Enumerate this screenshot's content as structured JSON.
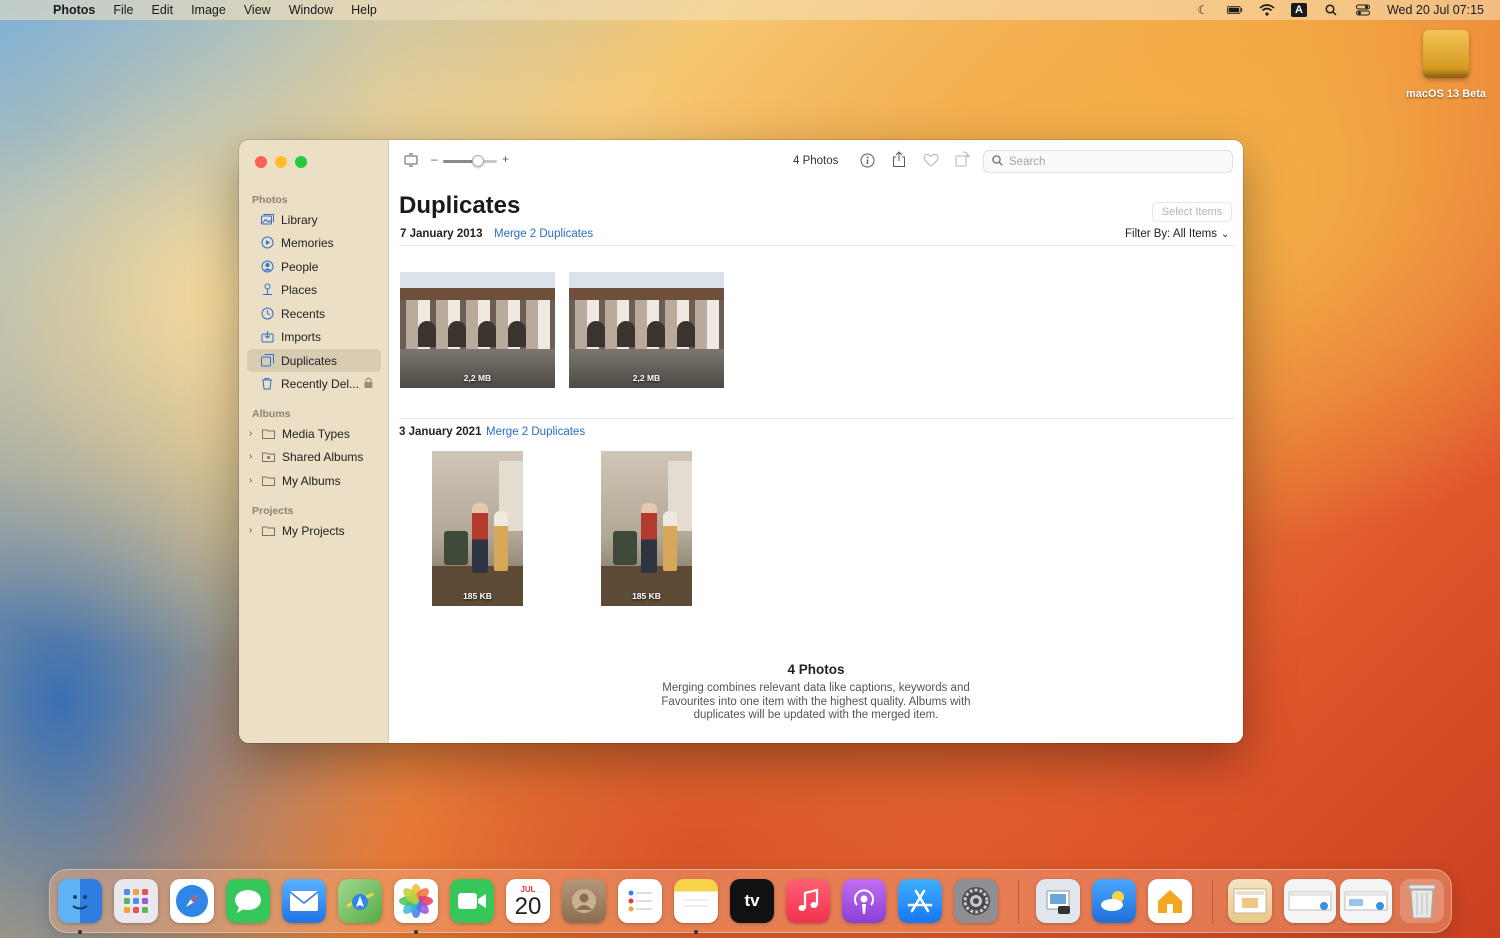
{
  "menubar": {
    "apple": "",
    "items": [
      "Photos",
      "File",
      "Edit",
      "Image",
      "View",
      "Window",
      "Help"
    ],
    "kbd": "A",
    "datetime": "Wed 20 Jul  07:15"
  },
  "desktop": {
    "disk_label": "macOS 13 Beta"
  },
  "sidebar": {
    "photos_header": "Photos",
    "photos_items": [
      {
        "label": "Library",
        "icon": "library-icon"
      },
      {
        "label": "Memories",
        "icon": "memories-icon"
      },
      {
        "label": "People",
        "icon": "people-icon"
      },
      {
        "label": "Places",
        "icon": "places-icon"
      },
      {
        "label": "Recents",
        "icon": "recents-icon"
      },
      {
        "label": "Imports",
        "icon": "imports-icon"
      },
      {
        "label": "Duplicates",
        "icon": "duplicates-icon",
        "selected": true
      },
      {
        "label": "Recently Del...",
        "icon": "trash-icon"
      }
    ],
    "albums_header": "Albums",
    "album_items": [
      "Media Types",
      "Shared Albums",
      "My Albums"
    ],
    "projects_header": "Projects",
    "project_items": [
      "My Projects"
    ]
  },
  "toolbar": {
    "zoom_minus": "–",
    "zoom_plus": "+",
    "zoom_level": 0.65,
    "photo_count": "4 Photos",
    "search_placeholder": "Search"
  },
  "main": {
    "title": "Duplicates",
    "select_items": "Select Items",
    "filter_label": "Filter By: All Items",
    "groups": [
      {
        "date": "7 January 2013",
        "merge": "Merge 2 Duplicates",
        "sizes": [
          "2,2 MB",
          "2,2 MB"
        ]
      },
      {
        "date": "3 January 2021",
        "merge": "Merge 2 Duplicates",
        "sizes": [
          "185 KB",
          "185 KB"
        ]
      }
    ],
    "footer_title": "4 Photos",
    "footer_desc": "Merging combines relevant data like captions, keywords and Favourites into one item with the highest quality. Albums with duplicates will be updated with the merged item."
  },
  "dock": {
    "calendar_month": "JUL",
    "calendar_day": "20",
    "tv_label": "tv",
    "colors": {
      "finder": "#3a8ee6",
      "launchpad": "#e8e8ee",
      "safari": "#2f86e6",
      "messages": "#35c759",
      "mail": "#3b8ef0",
      "maps": "#6bbf59",
      "photos": "#ffffff",
      "facetime": "#35c759",
      "calendar": "#ffffff",
      "contacts": "#a58a66",
      "reminders": "#ffffff",
      "notes": "#f7d34a",
      "tv": "#111111",
      "music": "#f43c55",
      "podcasts": "#9b4fe0",
      "appstore": "#1f8ff5",
      "settings": "#8e8e93",
      "preview": "#dfe6ee",
      "weather": "#3a8ee6",
      "home": "#f5a623",
      "trash": "#d6d6d6"
    }
  }
}
